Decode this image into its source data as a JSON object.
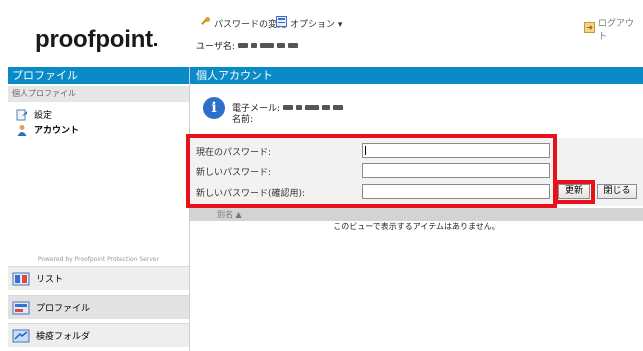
{
  "app": {
    "logo_text": "proofpoint"
  },
  "topbar": {
    "change_password": "パスワードの変更",
    "options": "オプション ▾",
    "logout": "ログアウト"
  },
  "user": {
    "label": "ユーザ名:"
  },
  "left_panel": {
    "header": "プロファイル",
    "subheader": "個人プロファイル",
    "items": [
      {
        "label": "設定",
        "icon": "settings-icon"
      },
      {
        "label": "アカウント",
        "icon": "account-icon"
      }
    ],
    "powered_by": "Powered by Proofpoint Protection Server",
    "bottom_nav": [
      {
        "label": "リスト",
        "icon": "list-icon"
      },
      {
        "label": "プロファイル",
        "icon": "profile-icon"
      },
      {
        "label": "検疫フォルダ",
        "icon": "quarantine-icon"
      }
    ]
  },
  "main": {
    "header": "個人アカウント",
    "email_label": "電子メール:",
    "name_label": "名前:",
    "form": {
      "current_password_label": "現在のパスワード:",
      "new_password_label": "新しいパスワード:",
      "confirm_password_label": "新しいパスワード(確認用):",
      "current_password_value": "",
      "new_password_value": "",
      "confirm_password_value": ""
    },
    "buttons": {
      "update": "更新",
      "close": "閉じる"
    },
    "grid": {
      "column_alias": "別名 ▲",
      "empty_message": "このビューで表示するアイテムはありません。"
    }
  },
  "colors": {
    "accent": "#0a8ac7",
    "highlight": "#e8101a"
  }
}
